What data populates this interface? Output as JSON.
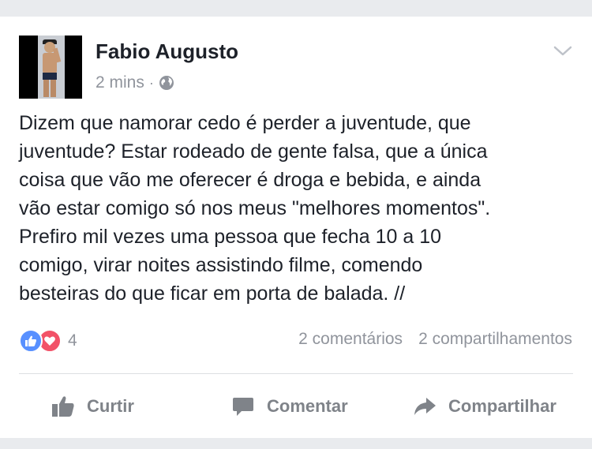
{
  "post": {
    "author": "Fabio Augusto",
    "time": "2 mins",
    "separator": "·",
    "privacy_icon": "globe-icon",
    "menu_icon": "chevron-down-icon",
    "text": "Dizem que namorar cedo é perder a juventude, que\njuventude? Estar rodeado de gente falsa, que a única\ncoisa que vão me oferecer é droga e bebida, e ainda\nvão estar comigo só nos meus \"melhores momentos\".\nPrefiro mil vezes uma pessoa que fecha 10 a 10\ncomigo, virar noites assistindo filme, comendo\nbesteiras do que ficar em porta de balada. //"
  },
  "reactions": {
    "icons": [
      "like-reaction-icon",
      "love-reaction-icon"
    ],
    "count": "4",
    "comments": "2 comentários",
    "shares": "2 compartilhamentos"
  },
  "actions": {
    "like": "Curtir",
    "comment": "Comentar",
    "share": "Compartilhar"
  },
  "colors": {
    "like_blue": "#5890ff",
    "love_red": "#f25268",
    "muted_text": "#90949c",
    "background_gray": "#e9ebee"
  }
}
